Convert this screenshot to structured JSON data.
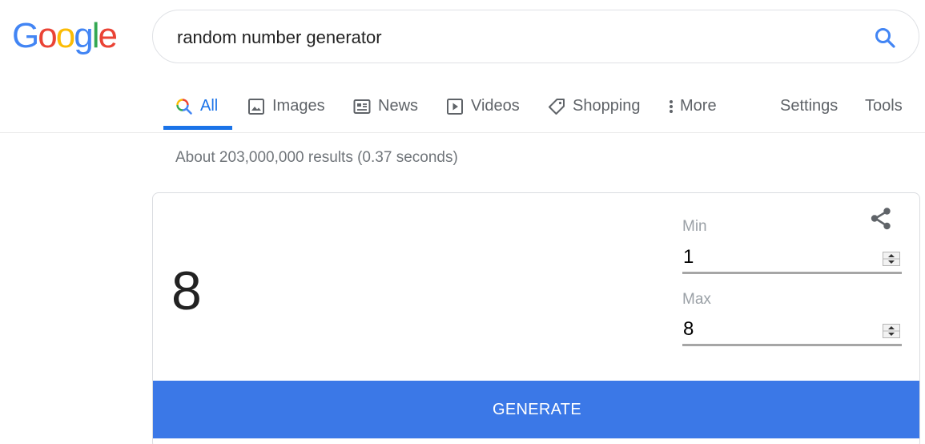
{
  "header": {
    "logo_letters": [
      "G",
      "o",
      "o",
      "g",
      "l",
      "e"
    ],
    "search": {
      "value": "random number generator"
    }
  },
  "tabs": [
    {
      "label": "All",
      "icon": "search-icon",
      "active": true
    },
    {
      "label": "Images",
      "icon": "image-icon"
    },
    {
      "label": "News",
      "icon": "news-icon"
    },
    {
      "label": "Videos",
      "icon": "play-icon"
    },
    {
      "label": "Shopping",
      "icon": "tag-icon"
    },
    {
      "label": "More",
      "icon": "more-vert-icon"
    },
    {
      "label": "Settings"
    },
    {
      "label": "Tools"
    }
  ],
  "result_stats": "About 203,000,000 results (0.37 seconds)",
  "rng": {
    "result": "8",
    "min_label": "Min",
    "min_value": "1",
    "max_label": "Max",
    "max_value": "8",
    "generate_label": "GENERATE",
    "share_icon": "share-icon"
  },
  "colors": {
    "accent_blue": "#1a73e8",
    "generate_button": "#3b78e7",
    "google_blue": "#4285f4",
    "google_red": "#ea4335",
    "google_yellow": "#fbbc05",
    "google_green": "#34a853"
  }
}
